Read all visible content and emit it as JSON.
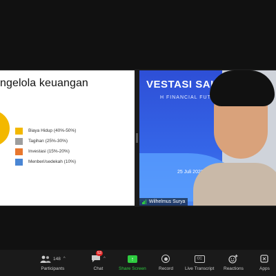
{
  "slide": {
    "title": "ngelola keuangan",
    "legend": [
      {
        "label": "Biaya Hidup (40%-50%)",
        "color": "#f3b800"
      },
      {
        "label": "Tagihan (25%-30%)",
        "color": "#9e9e9e"
      },
      {
        "label": "Investasi (15%-20%)",
        "color": "#e8772e"
      },
      {
        "label": "Menberi/sedekah (10%)",
        "color": "#4a86d4"
      }
    ],
    "pie_color": "#f3b800"
  },
  "video": {
    "background_title": "VESTASI SAHAM",
    "background_subtitle": "H FINANCIAL FUTURE",
    "background_date": "25 Juli 2022",
    "participant_name": "Wilhelmus Surya"
  },
  "toolbar": {
    "participants": {
      "label": "Participants",
      "count": "148"
    },
    "chat": {
      "label": "Chat",
      "badge": "53"
    },
    "share_screen": {
      "label": "Share Screen"
    },
    "record": {
      "label": "Record"
    },
    "live_transcript": {
      "label": "Live Transcript",
      "icon_text": "CC"
    },
    "reactions": {
      "label": "Reactions"
    },
    "apps": {
      "label": "Apps"
    }
  }
}
